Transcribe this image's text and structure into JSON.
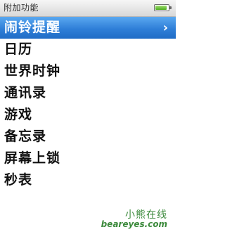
{
  "status_bar": {
    "title": "附加功能"
  },
  "menu": {
    "items": [
      {
        "label": "闹铃提醒",
        "selected": true
      },
      {
        "label": "日历",
        "selected": false
      },
      {
        "label": "世界时钟",
        "selected": false
      },
      {
        "label": "通讯录",
        "selected": false
      },
      {
        "label": "游戏",
        "selected": false
      },
      {
        "label": "备忘录",
        "selected": false
      },
      {
        "label": "屏幕上锁",
        "selected": false
      },
      {
        "label": "秒表",
        "selected": false
      }
    ],
    "chevron_glyph": "›"
  },
  "battery": {
    "level": 0.9
  },
  "watermark": {
    "cn": "小熊在线",
    "en": "beareyes.com"
  },
  "colors": {
    "selection": "#2f7fd8",
    "battery_fill": "#4fae22",
    "watermark": "#3c8a3c"
  }
}
